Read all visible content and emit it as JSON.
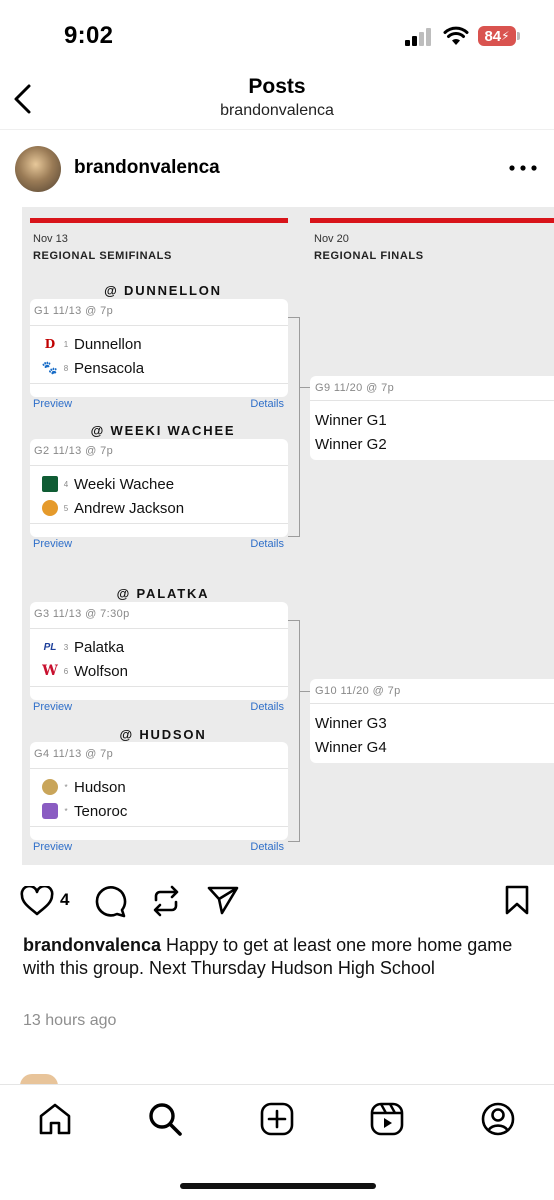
{
  "status_bar": {
    "time": "9:02",
    "battery": "84"
  },
  "header": {
    "title": "Posts",
    "subtitle": "brandonvalenca"
  },
  "post": {
    "username": "brandonvalenca",
    "likes": "4",
    "caption_user": "brandonvalenca",
    "caption_text": " Happy to get at least one more home game with this group. Next Thursday Hudson High School",
    "time_ago": "13 hours ago"
  },
  "bracket": {
    "rounds": [
      {
        "date": "Nov 13",
        "name": "REGIONAL SEMIFINALS"
      },
      {
        "date": "Nov 20",
        "name": "REGIONAL FINALS"
      }
    ],
    "games": [
      {
        "venue": "@ DUNNELLON",
        "label": "G1 11/13 @ 7p",
        "teams": [
          {
            "seed": "1",
            "name": "Dunnellon",
            "logo": "D"
          },
          {
            "seed": "8",
            "name": "Pensacola",
            "logo": "🐾"
          }
        ]
      },
      {
        "venue": "@ WEEKI WACHEE",
        "label": "G2 11/13 @ 7p",
        "teams": [
          {
            "seed": "4",
            "name": "Weeki Wachee",
            "logo": ""
          },
          {
            "seed": "5",
            "name": "Andrew Jackson",
            "logo": ""
          }
        ]
      },
      {
        "venue": "@ PALATKA",
        "label": "G3 11/13 @ 7:30p",
        "teams": [
          {
            "seed": "3",
            "name": "Palatka",
            "logo": "PL"
          },
          {
            "seed": "6",
            "name": "Wolfson",
            "logo": "W"
          }
        ]
      },
      {
        "venue": "@ HUDSON",
        "label": "G4 11/13 @ 7p",
        "teams": [
          {
            "seed": "*",
            "name": "Hudson",
            "logo": ""
          },
          {
            "seed": "*",
            "name": "Tenoroc",
            "logo": ""
          }
        ]
      }
    ],
    "finals": [
      {
        "label": "G9 11/20 @ 7p",
        "teams": [
          "Winner G1",
          "Winner G2"
        ]
      },
      {
        "label": "G10 11/20 @ 7p",
        "teams": [
          "Winner G3",
          "Winner G4"
        ]
      }
    ],
    "preview_label": "Preview",
    "details_label": "Details"
  },
  "colors": {
    "bracket_red": "#d8141a",
    "link_blue": "#2f6fc9",
    "bracket_bg": "#ebebeb"
  },
  "tabs": [
    "home-icon",
    "search-icon",
    "create-icon",
    "reels-icon",
    "profile-icon"
  ]
}
